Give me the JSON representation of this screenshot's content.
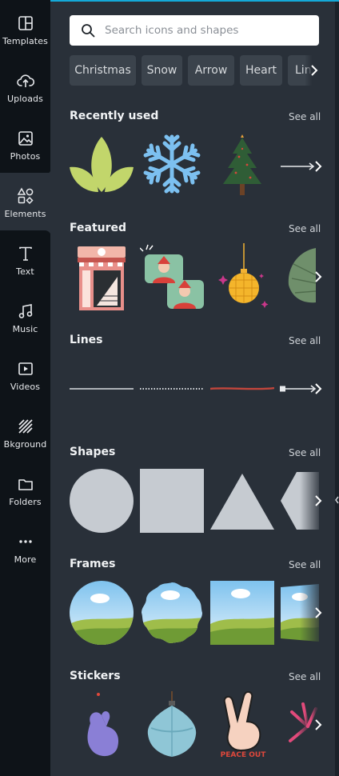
{
  "sidebar": {
    "items": [
      {
        "label": "Templates",
        "icon": "templates-icon"
      },
      {
        "label": "Uploads",
        "icon": "upload-cloud-icon"
      },
      {
        "label": "Photos",
        "icon": "photo-icon"
      },
      {
        "label": "Elements",
        "icon": "shapes-icon"
      },
      {
        "label": "Text",
        "icon": "text-icon"
      },
      {
        "label": "Music",
        "icon": "music-note-icon"
      },
      {
        "label": "Videos",
        "icon": "video-icon"
      },
      {
        "label": "Bkground",
        "icon": "background-stripes-icon"
      },
      {
        "label": "Folders",
        "icon": "folder-icon"
      },
      {
        "label": "More",
        "icon": "more-dots-icon"
      }
    ],
    "active": "Elements"
  },
  "search": {
    "placeholder": "Search icons and shapes",
    "value": ""
  },
  "chips": [
    "Christmas",
    "Snow",
    "Arrow",
    "Heart",
    "Line"
  ],
  "sections": {
    "recently_used": {
      "title": "Recently used",
      "see_all": "See all"
    },
    "featured": {
      "title": "Featured",
      "see_all": "See all"
    },
    "lines": {
      "title": "Lines",
      "see_all": "See all"
    },
    "shapes": {
      "title": "Shapes",
      "see_all": "See all"
    },
    "frames": {
      "title": "Frames",
      "see_all": "See all"
    },
    "stickers": {
      "title": "Stickers",
      "see_all": "See all",
      "sticker_text": "PEACE OUT"
    }
  },
  "colors": {
    "panel": "#293039",
    "sidebar": "#0e1318",
    "accent_top": "#14a9d9",
    "shape_fill": "#c6cbd1",
    "leaf_green": "#c2d66b",
    "snowflake_blue": "#7cc0f0"
  }
}
